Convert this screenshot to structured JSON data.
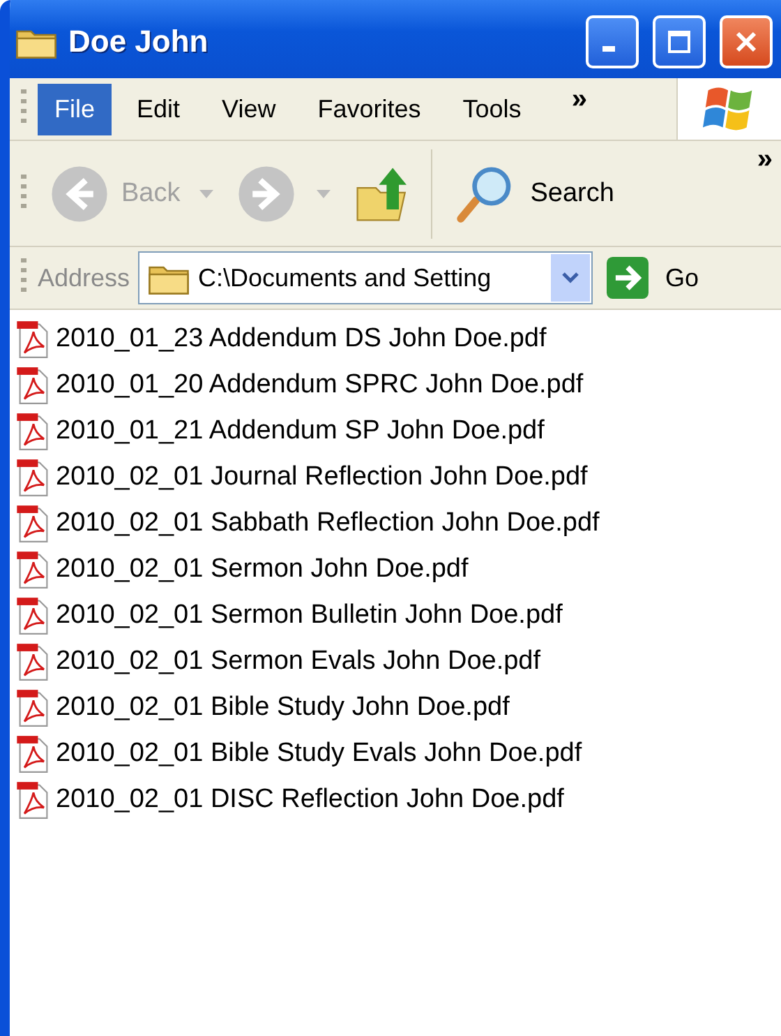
{
  "window": {
    "title": "Doe John"
  },
  "menu": [
    {
      "label": "File",
      "selected": true
    },
    {
      "label": "Edit",
      "selected": false
    },
    {
      "label": "View",
      "selected": false
    },
    {
      "label": "Favorites",
      "selected": false
    },
    {
      "label": "Tools",
      "selected": false
    }
  ],
  "menu_overflow": "»",
  "toolbar": {
    "back": {
      "label": "Back",
      "disabled": true
    },
    "forward": {
      "disabled": true
    },
    "search": {
      "label": "Search"
    },
    "overflow": "»"
  },
  "address": {
    "label": "Address",
    "value": "C:\\Documents and Setting",
    "go": "Go"
  },
  "files": [
    {
      "name": "2010_01_23 Addendum DS John Doe.pdf"
    },
    {
      "name": "2010_01_20 Addendum SPRC John Doe.pdf"
    },
    {
      "name": "2010_01_21 Addendum SP John Doe.pdf"
    },
    {
      "name": "2010_02_01 Journal Reflection John Doe.pdf"
    },
    {
      "name": "2010_02_01 Sabbath Reflection John Doe.pdf"
    },
    {
      "name": "2010_02_01 Sermon John Doe.pdf"
    },
    {
      "name": "2010_02_01 Sermon Bulletin John Doe.pdf"
    },
    {
      "name": "2010_02_01 Sermon Evals John Doe.pdf"
    },
    {
      "name": "2010_02_01 Bible Study John Doe.pdf"
    },
    {
      "name": "2010_02_01 Bible Study Evals John Doe.pdf"
    },
    {
      "name": "2010_02_01 DISC Reflection John Doe.pdf"
    }
  ]
}
